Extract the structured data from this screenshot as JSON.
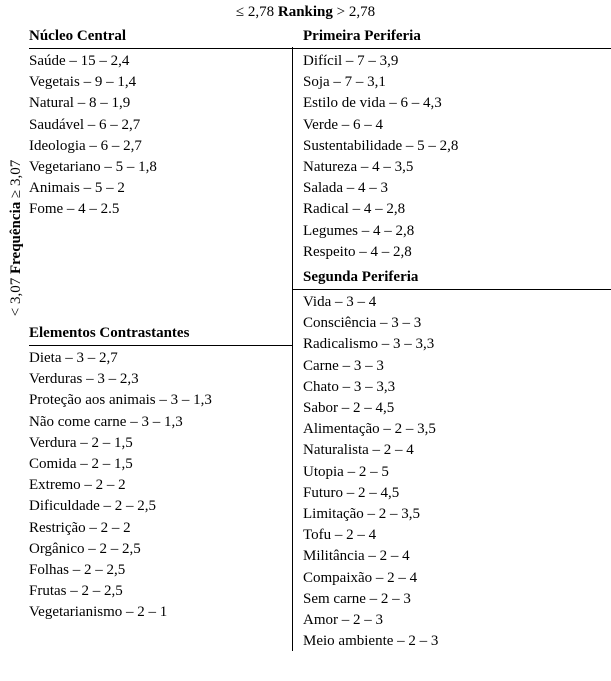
{
  "axis_labels": {
    "vertical_axis": {
      "low": "< 3,07",
      "name": "Frequência",
      "high": "≥ 3,07"
    },
    "horizontal_axis": {
      "low": "≤ 2,78",
      "name": "Ranking",
      "high": "> 2,78"
    }
  },
  "quadrants": {
    "nucleo_central": {
      "title": "Núcleo Central",
      "items": [
        "Saúde – 15 – 2,4",
        "Vegetais – 9 – 1,4",
        "Natural – 8 – 1,9",
        "Saudável – 6 – 2,7",
        "Ideologia – 6 – 2,7",
        "Vegetariano – 5 – 1,8",
        "Animais – 5 – 2",
        "Fome – 4 – 2.5"
      ]
    },
    "primeira_periferia": {
      "title": "Primeira Periferia",
      "items": [
        "Difícil – 7 – 3,9",
        "Soja – 7 – 3,1",
        "Estilo de vida – 6 – 4,3",
        "Verde – 6 – 4",
        "Sustentabilidade – 5 – 2,8",
        "Natureza – 4 – 3,5",
        "Salada – 4 – 3",
        "Radical – 4 – 2,8",
        "Legumes – 4 – 2,8",
        "Respeito – 4 – 2,8"
      ]
    },
    "elementos_contrastantes": {
      "title": "Elementos Contrastantes",
      "items": [
        "Dieta – 3 – 2,7",
        "Verduras – 3 – 2,3",
        "Proteção aos animais – 3 – 1,3",
        "Não come carne – 3 – 1,3",
        "Verdura – 2 – 1,5",
        "Comida – 2 – 1,5",
        "Extremo – 2 – 2",
        "Dificuldade – 2 – 2,5",
        "Restrição – 2 – 2",
        "Orgânico – 2 – 2,5",
        "Folhas – 2 – 2,5",
        "Frutas – 2 – 2,5",
        "Vegetarianismo – 2 – 1"
      ]
    },
    "segunda_periferia": {
      "title": "Segunda Periferia",
      "items": [
        "Vida – 3 – 4",
        "Consciência – 3 – 3",
        "Radicalismo – 3 – 3,3",
        "Carne – 3 – 3",
        "Chato – 3 – 3,3",
        "Sabor – 2 – 4,5",
        "Alimentação – 2 – 3,5",
        "Naturalista – 2 – 4",
        "Utopia – 2 – 5",
        "Futuro – 2 – 4,5",
        "Limitação – 2 – 3,5",
        "Tofu – 2 – 4",
        "Militância – 2 – 4",
        "Compaixão – 2 – 4",
        "Sem carne – 2 – 3",
        "Amor – 2 – 3",
        "Meio ambiente – 2 – 3"
      ]
    }
  }
}
